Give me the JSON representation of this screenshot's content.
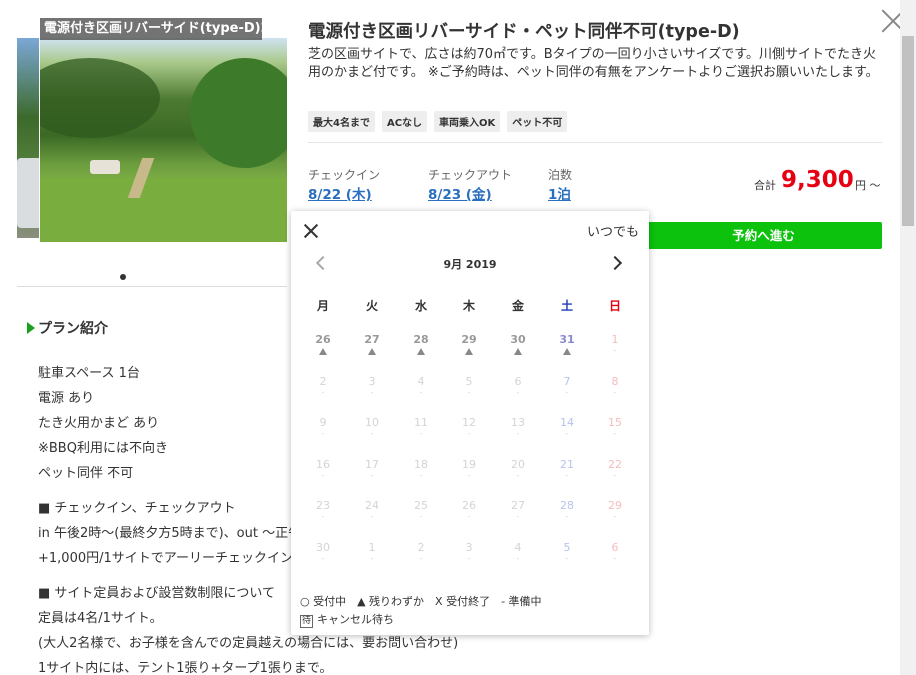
{
  "gallery": {
    "caption": "電源付き区画リバーサイド(type-D)2"
  },
  "header": {
    "title": "電源付き区画リバーサイド・ペット同伴不可(type-D)",
    "description": "芝の区画サイトで、広さは約70㎡です。Bタイプの一回り小さいサイズです。川側サイトでたき火用のかまど付です。 ※ご予約時は、ペット同伴の有無をアンケートよりご選択お願いいたします。",
    "tags": [
      "最大4名まで",
      "ACなし",
      "車両乗入OK",
      "ペット不可"
    ]
  },
  "booking": {
    "checkin_label": "チェックイン",
    "checkin_value": "8/22 (木)",
    "checkout_label": "チェックアウト",
    "checkout_value": "8/23 (金)",
    "nights_label": "泊数",
    "nights_value": "1泊",
    "total_label": "合計",
    "total_price": "9,300",
    "total_unit": "円 ～",
    "reserve_label": "予約へ進む"
  },
  "plan": {
    "heading": "プラン紹介",
    "lines": [
      "駐車スペース 1台",
      "電源 あり",
      "たき火用かまど あり",
      "※BBQ利用には不向き",
      "ペット同伴 不可",
      "■ チェックイン、チェックアウト",
      "in 午後2時～(最終夕方5時まで)、out ～正午",
      "+1,000円/1サイトでアーリーチェックイン、",
      "■ サイト定員および設営数制限について",
      "定員は4名/1サイト。",
      "(大人2名様で、お子様を含んでの定員越えの場合には、要お問い合わせ)",
      "1サイト内には、テント1張り+タープ1張りまで。"
    ]
  },
  "calendar": {
    "anytime_label": "いつでも",
    "month_label": "9月 2019",
    "weekdays": [
      "月",
      "火",
      "水",
      "木",
      "金",
      "土",
      "日"
    ],
    "weeks": [
      [
        {
          "d": "26",
          "s": "▲",
          "f": false
        },
        {
          "d": "27",
          "s": "▲",
          "f": false
        },
        {
          "d": "28",
          "s": "▲",
          "f": false
        },
        {
          "d": "29",
          "s": "▲",
          "f": false
        },
        {
          "d": "30",
          "s": "▲",
          "f": false
        },
        {
          "d": "31",
          "s": "▲",
          "f": false
        },
        {
          "d": "1",
          "s": "-",
          "f": true
        }
      ],
      [
        {
          "d": "2",
          "s": "-",
          "f": true
        },
        {
          "d": "3",
          "s": "-",
          "f": true
        },
        {
          "d": "4",
          "s": "-",
          "f": true
        },
        {
          "d": "5",
          "s": "-",
          "f": true
        },
        {
          "d": "6",
          "s": "-",
          "f": true
        },
        {
          "d": "7",
          "s": "-",
          "f": true
        },
        {
          "d": "8",
          "s": "-",
          "f": true
        }
      ],
      [
        {
          "d": "9",
          "s": "-",
          "f": true
        },
        {
          "d": "10",
          "s": "-",
          "f": true
        },
        {
          "d": "11",
          "s": "-",
          "f": true
        },
        {
          "d": "12",
          "s": "-",
          "f": true
        },
        {
          "d": "13",
          "s": "-",
          "f": true
        },
        {
          "d": "14",
          "s": "-",
          "f": true
        },
        {
          "d": "15",
          "s": "-",
          "f": true
        }
      ],
      [
        {
          "d": "16",
          "s": "-",
          "f": true
        },
        {
          "d": "17",
          "s": "-",
          "f": true
        },
        {
          "d": "18",
          "s": "-",
          "f": true
        },
        {
          "d": "19",
          "s": "-",
          "f": true
        },
        {
          "d": "20",
          "s": "-",
          "f": true
        },
        {
          "d": "21",
          "s": "-",
          "f": true
        },
        {
          "d": "22",
          "s": "-",
          "f": true
        }
      ],
      [
        {
          "d": "23",
          "s": "-",
          "f": true
        },
        {
          "d": "24",
          "s": "-",
          "f": true
        },
        {
          "d": "25",
          "s": "-",
          "f": true
        },
        {
          "d": "26",
          "s": "-",
          "f": true
        },
        {
          "d": "27",
          "s": "-",
          "f": true
        },
        {
          "d": "28",
          "s": "-",
          "f": true
        },
        {
          "d": "29",
          "s": "-",
          "f": true
        }
      ],
      [
        {
          "d": "30",
          "s": "-",
          "f": true
        },
        {
          "d": "1",
          "s": "-",
          "f": true
        },
        {
          "d": "2",
          "s": "-",
          "f": true
        },
        {
          "d": "3",
          "s": "-",
          "f": true
        },
        {
          "d": "4",
          "s": "-",
          "f": true
        },
        {
          "d": "5",
          "s": "-",
          "f": true
        },
        {
          "d": "6",
          "s": "-",
          "f": true
        }
      ]
    ],
    "legend_line1": "○ 受付中　▲ 残りわずか　X 受付終了　- 準備中",
    "legend_waitlist_mark": "待",
    "legend_waitlist_label": "キャンセル待ち"
  },
  "colors": {
    "accent_green": "#0cc20c",
    "price_red": "#e60012",
    "link_blue": "#2a6fbf",
    "saturday_blue": "#1e3db8",
    "sunday_red": "#e60012"
  }
}
